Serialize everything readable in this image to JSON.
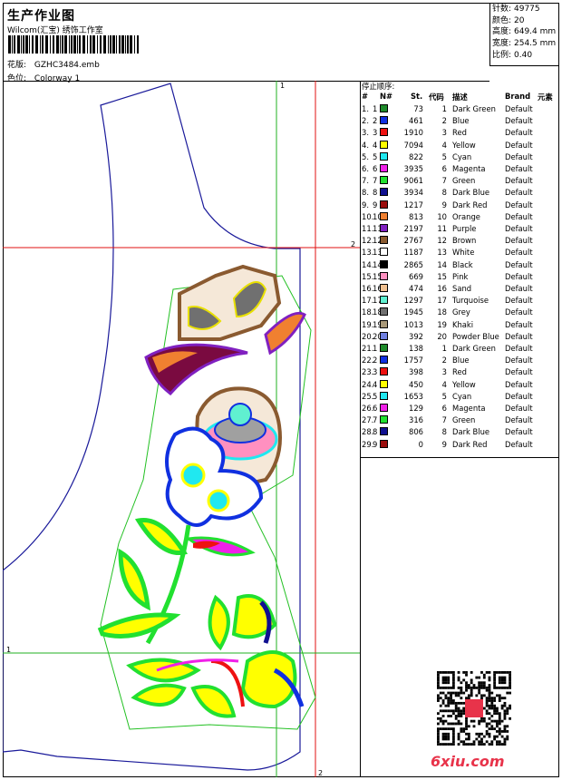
{
  "header": {
    "title": "生产作业图",
    "company": "Wilcom(汇宝) 绣饰工作室",
    "file_label": "花版:",
    "file_value": "GZHC3484.emb",
    "colorway_label": "色位:",
    "colorway_value": "Colorway 1"
  },
  "stats": [
    {
      "k": "针数:",
      "v": "49775"
    },
    {
      "k": "颜色:",
      "v": "20"
    },
    {
      "k": "高度:",
      "v": "649.4 mm"
    },
    {
      "k": "宽度:",
      "v": "254.5 mm"
    },
    {
      "k": "比例:",
      "v": "0.40"
    }
  ],
  "legend": {
    "title": "停止顺序:",
    "columns": [
      "#",
      "N#",
      "St.",
      "代码",
      "描述",
      "Brand",
      "元素"
    ],
    "rows": [
      {
        "n": "1.",
        "nn": "1",
        "color": "#1e8a2a",
        "st": "73",
        "code": "1",
        "desc": "Dark Green",
        "brand": "Default"
      },
      {
        "n": "2.",
        "nn": "2",
        "color": "#1030e0",
        "st": "461",
        "code": "2",
        "desc": "Blue",
        "brand": "Default"
      },
      {
        "n": "3.",
        "nn": "3",
        "color": "#ee1111",
        "st": "1910",
        "code": "3",
        "desc": "Red",
        "brand": "Default"
      },
      {
        "n": "4.",
        "nn": "4",
        "color": "#ffff00",
        "st": "7094",
        "code": "4",
        "desc": "Yellow",
        "brand": "Default"
      },
      {
        "n": "5.",
        "nn": "5",
        "color": "#20e8f0",
        "st": "822",
        "code": "5",
        "desc": "Cyan",
        "brand": "Default"
      },
      {
        "n": "6.",
        "nn": "6",
        "color": "#f020e8",
        "st": "3935",
        "code": "6",
        "desc": "Magenta",
        "brand": "Default"
      },
      {
        "n": "7.",
        "nn": "7",
        "color": "#22e030",
        "st": "9061",
        "code": "7",
        "desc": "Green",
        "brand": "Default"
      },
      {
        "n": "8.",
        "nn": "8",
        "color": "#101090",
        "st": "3934",
        "code": "8",
        "desc": "Dark Blue",
        "brand": "Default"
      },
      {
        "n": "9.",
        "nn": "9",
        "color": "#9a0c0c",
        "st": "1217",
        "code": "9",
        "desc": "Dark Red",
        "brand": "Default"
      },
      {
        "n": "10.",
        "nn": "10",
        "color": "#f08030",
        "st": "813",
        "code": "10",
        "desc": "Orange",
        "brand": "Default"
      },
      {
        "n": "11.",
        "nn": "11",
        "color": "#8020c0",
        "st": "2197",
        "code": "11",
        "desc": "Purple",
        "brand": "Default"
      },
      {
        "n": "12.",
        "nn": "12",
        "color": "#8a5a30",
        "st": "2767",
        "code": "12",
        "desc": "Brown",
        "brand": "Default"
      },
      {
        "n": "13.",
        "nn": "13",
        "color": "#ffffff",
        "st": "1187",
        "code": "13",
        "desc": "White",
        "brand": "Default"
      },
      {
        "n": "14.",
        "nn": "14",
        "color": "#000000",
        "st": "2865",
        "code": "14",
        "desc": "Black",
        "brand": "Default"
      },
      {
        "n": "15.",
        "nn": "15",
        "color": "#ff90c0",
        "st": "669",
        "code": "15",
        "desc": "Pink",
        "brand": "Default"
      },
      {
        "n": "16.",
        "nn": "16",
        "color": "#f0c090",
        "st": "474",
        "code": "16",
        "desc": "Sand",
        "brand": "Default"
      },
      {
        "n": "17.",
        "nn": "17",
        "color": "#60f0d0",
        "st": "1297",
        "code": "17",
        "desc": "Turquoise",
        "brand": "Default"
      },
      {
        "n": "18.",
        "nn": "18",
        "color": "#707070",
        "st": "1945",
        "code": "18",
        "desc": "Grey",
        "brand": "Default"
      },
      {
        "n": "19.",
        "nn": "19",
        "color": "#a89878",
        "st": "1013",
        "code": "19",
        "desc": "Khaki",
        "brand": "Default"
      },
      {
        "n": "20.",
        "nn": "20",
        "color": "#7080e0",
        "st": "392",
        "code": "20",
        "desc": "Powder Blue",
        "brand": "Default"
      },
      {
        "n": "21.",
        "nn": "1",
        "color": "#1e8a2a",
        "st": "138",
        "code": "1",
        "desc": "Dark Green",
        "brand": "Default"
      },
      {
        "n": "22.",
        "nn": "2",
        "color": "#1030e0",
        "st": "1757",
        "code": "2",
        "desc": "Blue",
        "brand": "Default"
      },
      {
        "n": "23.",
        "nn": "3",
        "color": "#ee1111",
        "st": "398",
        "code": "3",
        "desc": "Red",
        "brand": "Default"
      },
      {
        "n": "24.",
        "nn": "4",
        "color": "#ffff00",
        "st": "450",
        "code": "4",
        "desc": "Yellow",
        "brand": "Default"
      },
      {
        "n": "25.",
        "nn": "5",
        "color": "#20e8f0",
        "st": "1653",
        "code": "5",
        "desc": "Cyan",
        "brand": "Default"
      },
      {
        "n": "26.",
        "nn": "6",
        "color": "#f020e8",
        "st": "129",
        "code": "6",
        "desc": "Magenta",
        "brand": "Default"
      },
      {
        "n": "27.",
        "nn": "7",
        "color": "#22e030",
        "st": "316",
        "code": "7",
        "desc": "Green",
        "brand": "Default"
      },
      {
        "n": "28.",
        "nn": "8",
        "color": "#101090",
        "st": "806",
        "code": "8",
        "desc": "Dark Blue",
        "brand": "Default"
      },
      {
        "n": "29.",
        "nn": "9",
        "color": "#9a0c0c",
        "st": "0",
        "code": "9",
        "desc": "Dark Red",
        "brand": "Default"
      }
    ]
  },
  "design": {
    "markers": {
      "v1": "1",
      "v2": "2",
      "h1": "1",
      "h2": "2"
    }
  },
  "watermark": "6xiu.com"
}
